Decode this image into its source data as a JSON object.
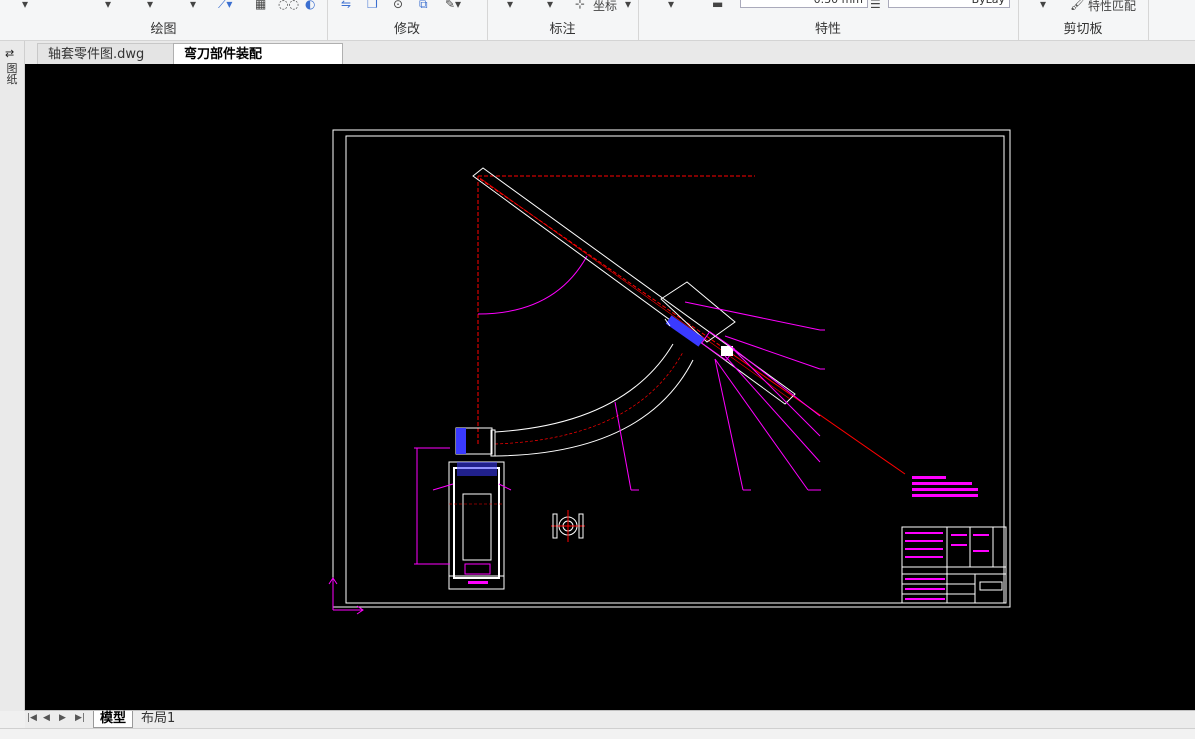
{
  "ribbon": {
    "groups": [
      {
        "label": "绘图"
      },
      {
        "label": "修改"
      },
      {
        "label": "标注"
      },
      {
        "label": "特性"
      },
      {
        "label": "剪切板"
      }
    ],
    "coord_label": "坐标",
    "lineweight_value": "0.30 mm",
    "linetype_value": "ByLay",
    "match_props_label": "特性匹配"
  },
  "leftbar": {
    "label": "图纸"
  },
  "tabs": [
    {
      "label": "轴套零件图.dwg",
      "active": false
    },
    {
      "label": "弯刀部件装配图.dwg*",
      "active": true
    }
  ],
  "tab_close": "×",
  "layout_tabs": [
    {
      "label": "模型",
      "active": true
    },
    {
      "label": "布局1",
      "active": false
    }
  ],
  "nav_buttons": [
    "|◀",
    "◀",
    "▶",
    "▶|"
  ],
  "colors": {
    "canvas_bg": "#000000",
    "drawing_white": "#ffffff",
    "dim_magenta": "#ff00ff",
    "center_red": "#ff0000",
    "part_blue": "#3a3aff"
  }
}
